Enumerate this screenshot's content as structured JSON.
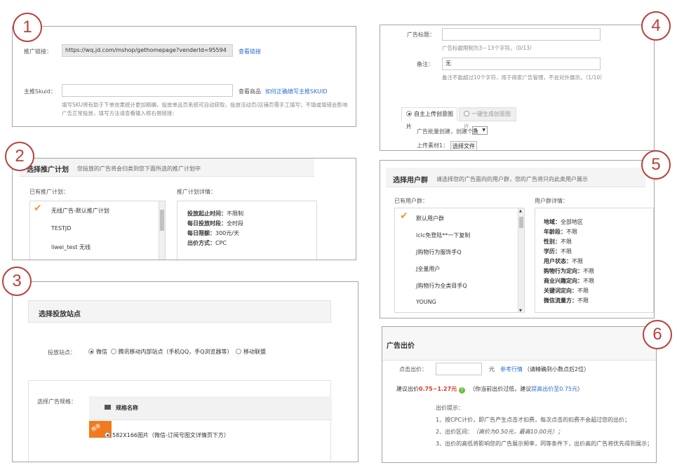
{
  "badges": [
    "1",
    "2",
    "3",
    "4",
    "5",
    "6"
  ],
  "p1": {
    "link_label": "推广链接：",
    "link_value": "https://wq.jd.com/mshop/gethomepage?venderId=95594",
    "view_link": "查看链接",
    "skuid_label": "主推Skuid：",
    "view_product": "查看商品",
    "how_to": "如何正确填写主推SKUID",
    "hint1": "填写SKU将有助于下单效果统计更加精确，投放单品页系统可自动获取，投放活动页/店铺页需手工填写；不填或填错会影响",
    "hint2": "广告正常投放，填写方法请查看输入框右侧链接："
  },
  "p2": {
    "title": "选择推广计划",
    "subtitle": "您投放的广告将会归类到您下面所选的推广计划中",
    "existing_label": "已有推广计划：",
    "plans": [
      "无线广告-默认推广计划",
      "TESTJD",
      "liwei_test 无线"
    ],
    "detail_label": "推广计划详情：",
    "details": [
      {
        "k": "投放起止时间：",
        "v": "不限制"
      },
      {
        "k": "每日投放时段：",
        "v": "全时段"
      },
      {
        "k": "每日限额：",
        "v": "300元/天"
      },
      {
        "k": "出价方式：",
        "v": "CPC"
      }
    ]
  },
  "p3": {
    "title": "选择投放站点",
    "site_label": "投放站点：",
    "sites": [
      "微信",
      "腾讯移动内部站点（手机QQ，手Q浏览器等）",
      "移动联盟"
    ],
    "spec_label": "选择广告规格：",
    "col_header": "规格名称",
    "tag": "推荐",
    "spec_item": "582X166图片（微信-订阅号图文详情页下方）"
  },
  "p4": {
    "title_label": "广告标题：",
    "title_value": "",
    "title_hint": "广告标题限制为3－13个字符。（0/13）",
    "note_label": "备注：",
    "note_value": "无",
    "note_hint": "备注不能超过10个字符，用于商家广告管理，不会对外展示。（1/10）",
    "tabs": [
      "自主上传创意图片",
      "一键生成创意图片"
    ],
    "batch_label": "广告批量创建，创建个数",
    "batch_value": "1",
    "upload_label": "上传素材1：",
    "upload_btn": "选择文件"
  },
  "p5": {
    "title": "选择用户群",
    "subtitle": "请选择您的广告面向的用户群，您的广告将只向此类用户展示",
    "existing_label": "已有用户群：",
    "groups": [
      "默认用户群",
      "lclc免登陆**一下复制",
      "J购物行为服饰手Q",
      "J全量用户",
      "J购物行为全类目手Q",
      "YOUNG"
    ],
    "detail_label": "用户群详情：",
    "details": [
      {
        "k": "地域：",
        "v": "全部地区"
      },
      {
        "k": "年龄段：",
        "v": "不限"
      },
      {
        "k": "性别：",
        "v": "不限"
      },
      {
        "k": "学历：",
        "v": "不限"
      },
      {
        "k": "用户状态：",
        "v": "不限"
      },
      {
        "k": "购物行为定向：",
        "v": "不限"
      },
      {
        "k": "商业兴趣定向：",
        "v": "不限"
      },
      {
        "k": "关键词定向：",
        "v": "不限"
      },
      {
        "k": "微信流量方：",
        "v": "不限"
      }
    ]
  },
  "p6": {
    "title": "广告出价",
    "bid_label": "点击出价：",
    "unit": "元",
    "ref_link": "参考行情",
    "precision": "（请精确到小数点后2位）",
    "suggest_prefix": "建议出价",
    "suggest_range": "0.75~1.27元",
    "suggest_note": "（你当前出价过低，建议",
    "suggest_link": "提高出价至0.75元",
    "suggest_end": "）",
    "tips_title": "出价提示：",
    "tip1": "1、按CPC计价，即广告产生点击才扣费，每次点击的扣费不会超过您的出价；",
    "tip2_prefix": "2、出价区间：",
    "tip2_value": "（高价为0.50元，最高10.00元）；",
    "tip3": "3、出价的高低将影响您的广告展示频率，同等条件下，出价高的广告将优先得到展示；"
  }
}
